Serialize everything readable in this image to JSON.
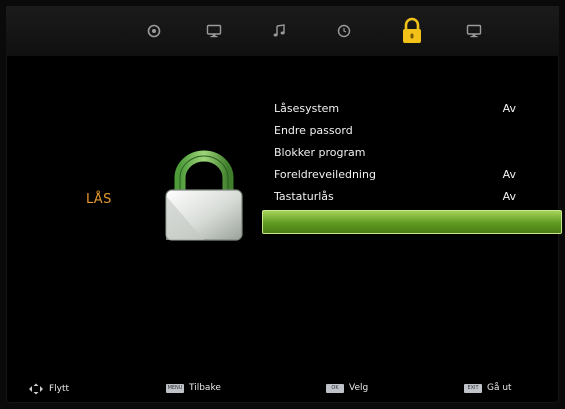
{
  "section_title": "LÅS",
  "top_tabs": [
    {
      "name": "picture",
      "icon": "picture-icon",
      "selected": false
    },
    {
      "name": "screen",
      "icon": "monitor-icon",
      "selected": false
    },
    {
      "name": "sound",
      "icon": "music-note-icon",
      "selected": false
    },
    {
      "name": "time",
      "icon": "clock-icon",
      "selected": false
    },
    {
      "name": "lock",
      "icon": "lock-icon",
      "selected": true
    },
    {
      "name": "setup",
      "icon": "monitor-icon",
      "selected": false
    }
  ],
  "menu": {
    "items": [
      {
        "label": "Låsesystem",
        "value": "Av"
      },
      {
        "label": "Endre passord",
        "value": ""
      },
      {
        "label": "Blokker program",
        "value": ""
      },
      {
        "label": "Foreldreveiledning",
        "value": "Av"
      },
      {
        "label": "Tastaturlås",
        "value": "Av"
      },
      {
        "label": "",
        "value": ""
      }
    ],
    "selected_index": 5
  },
  "bottom_hints": {
    "move": {
      "icon": "dpad-icon",
      "label": "Flytt"
    },
    "back": {
      "key": "MENU",
      "label": "Tilbake"
    },
    "select": {
      "key": "OK",
      "label": "Velg"
    },
    "exit": {
      "key": "EXIT",
      "label": "Gå ut"
    }
  },
  "colors": {
    "accent_orange": "#e59a2c",
    "selection_green": "#6fae2a",
    "lock_yellow": "#f2c21a"
  }
}
